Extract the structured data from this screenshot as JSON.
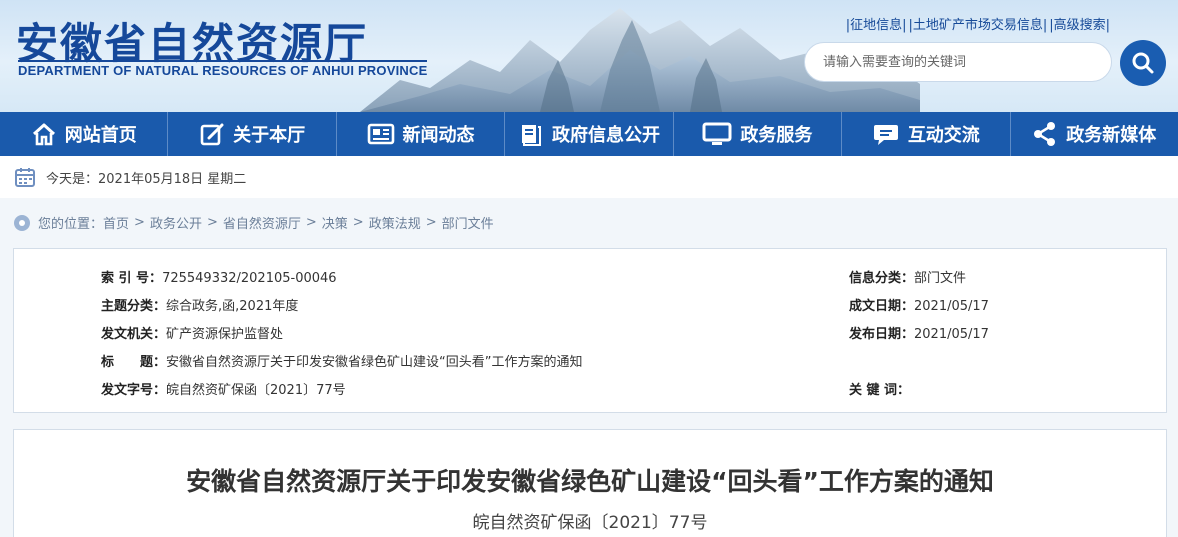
{
  "header": {
    "logo_cn": "安徽省自然资源厅",
    "logo_en": "DEPARTMENT OF NATURAL RESOURCES OF ANHUI PROVINCE",
    "top_links": [
      "|征地信息|",
      "|土地矿产市场交易信息|",
      "|高级搜索|"
    ],
    "search_placeholder": "请输入需要查询的关键词"
  },
  "nav": [
    {
      "label": "网站首页",
      "icon": "home-icon"
    },
    {
      "label": "关于本厅",
      "icon": "edit-icon"
    },
    {
      "label": "新闻动态",
      "icon": "news-icon"
    },
    {
      "label": "政府信息公开",
      "icon": "book-icon"
    },
    {
      "label": "政务服务",
      "icon": "monitor-icon"
    },
    {
      "label": "互动交流",
      "icon": "chat-icon"
    },
    {
      "label": "政务新媒体",
      "icon": "share-icon"
    }
  ],
  "date_bar": {
    "text": "今天是：2021年05月18日 星期二"
  },
  "breadcrumb": {
    "prefix": "您的位置：",
    "items": [
      "首页",
      "政务公开",
      "省自然资源厅",
      "决策",
      "政策法规",
      "部门文件"
    ],
    "separator": ">"
  },
  "info": {
    "index_label": "索 引 号：",
    "index_value": "725549332/202105-00046",
    "category_label": "信息分类：",
    "category_value": "部门文件",
    "topic_label": "主题分类：",
    "topic_value": "综合政务,函,2021年度",
    "created_label": "成文日期：",
    "created_value": "2021/05/17",
    "issuer_label": "发文机关：",
    "issuer_value": "矿产资源保护监督处",
    "published_label": "发布日期：",
    "published_value": "2021/05/17",
    "title_label": "标　　题：",
    "title_value": "安徽省自然资源厅关于印发安徽省绿色矿山建设“回头看”工作方案的通知",
    "docno_label": "发文字号：",
    "docno_value": "皖自然资矿保函〔2021〕77号",
    "keywords_label": "关 键 词：",
    "keywords_value": ""
  },
  "article": {
    "title": "安徽省自然资源厅关于印发安徽省绿色矿山建设“回头看”工作方案的通知",
    "doc_number": "皖自然资矿保函〔2021〕77号"
  },
  "colors": {
    "primary": "#1a5aac",
    "accent": "#15489a"
  }
}
